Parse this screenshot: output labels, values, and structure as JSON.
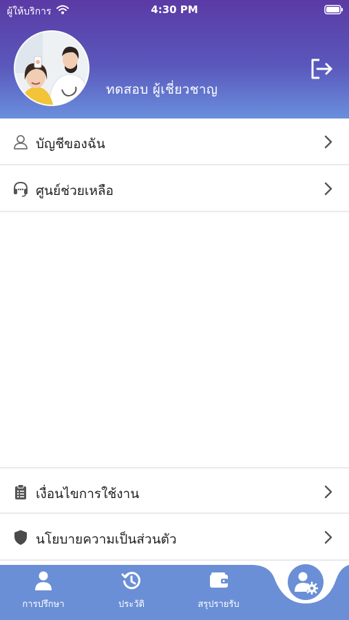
{
  "status_bar": {
    "carrier": "ผู้ให้บริการ",
    "time": "4:30 PM"
  },
  "profile": {
    "name": "ทดสอบ ผู้เชี่ยวชาญ"
  },
  "menu": {
    "account": "บัญชีของฉัน",
    "help": "ศูนย์ช่วยเหลือ",
    "terms": "เงื่อนไขการใช้งาน",
    "privacy": "นโยบายความเป็นส่วนตัว"
  },
  "tabs": {
    "consult": "การปรึกษา",
    "history": "ประวัติ",
    "income": "สรุปรายรับ"
  },
  "icons": {
    "wifi": "wifi-icon",
    "battery": "battery-icon",
    "logout": "logout-icon",
    "account": "person-icon",
    "help": "headset-icon",
    "terms": "clipboard-icon",
    "privacy": "shield-icon",
    "chevron": "chevron-right-icon",
    "consult": "person-icon",
    "history": "history-icon",
    "income": "wallet-icon",
    "settings": "user-settings-icon"
  },
  "colors": {
    "header_top": "#5b3aa5",
    "header_bottom": "#6a8fdd",
    "tabbar": "#6b8fd6",
    "divider": "#e9e9ee",
    "text": "#1f1f1f"
  }
}
